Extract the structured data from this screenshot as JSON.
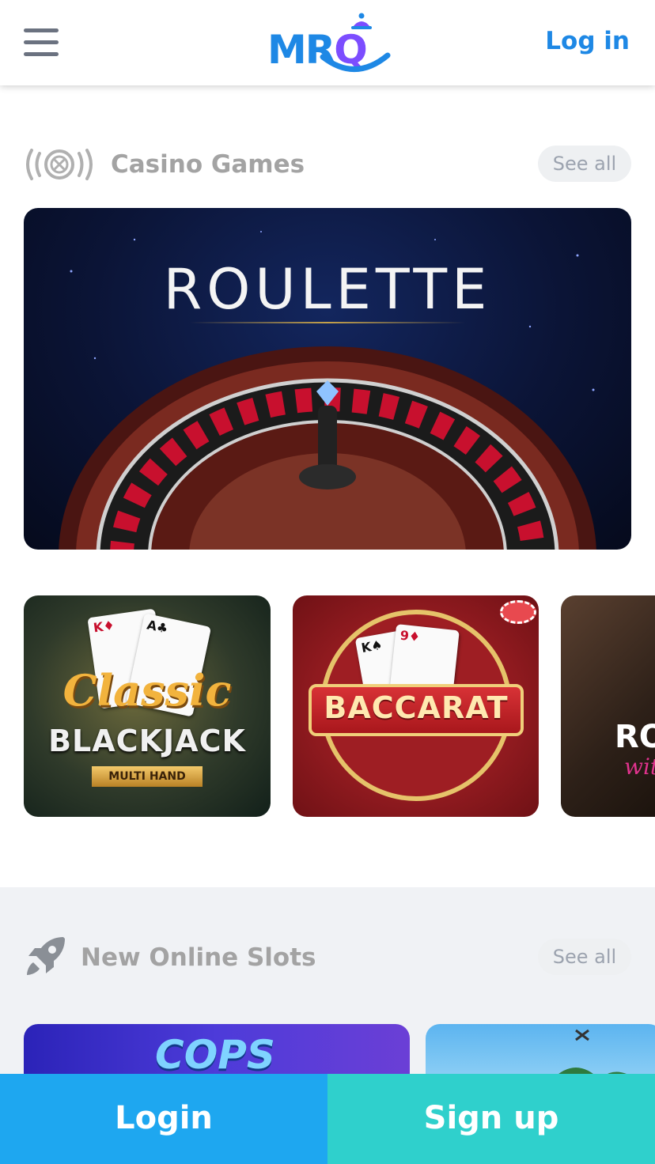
{
  "header": {
    "menu_icon": "hamburger-menu-icon",
    "logo": {
      "text_mr": "MR",
      "text_q": "Q"
    },
    "login_link": "Log in"
  },
  "casino_section": {
    "icon": "roulette-wheel-icon",
    "title": "Casino Games",
    "see_all": "See all",
    "featured": {
      "title": "ROULETTE"
    },
    "tiles": [
      {
        "line1": "Classic",
        "line2": "BLACKJACK",
        "line3": "MULTI HAND"
      },
      {
        "title": "BACCARAT"
      },
      {
        "line1": "RO",
        "line2": "wit"
      }
    ]
  },
  "slots_section": {
    "icon": "rocket-icon",
    "title": "New Online Slots",
    "see_all": "See all",
    "tiles": [
      {
        "title": "COPS"
      }
    ]
  },
  "bottom_bar": {
    "login": "Login",
    "signup": "Sign up"
  },
  "colors": {
    "brand_blue": "#1e88e5",
    "brand_purple": "#7c4dff",
    "login_bg": "#1ea7f0",
    "signup_bg": "#2fd0cc"
  }
}
